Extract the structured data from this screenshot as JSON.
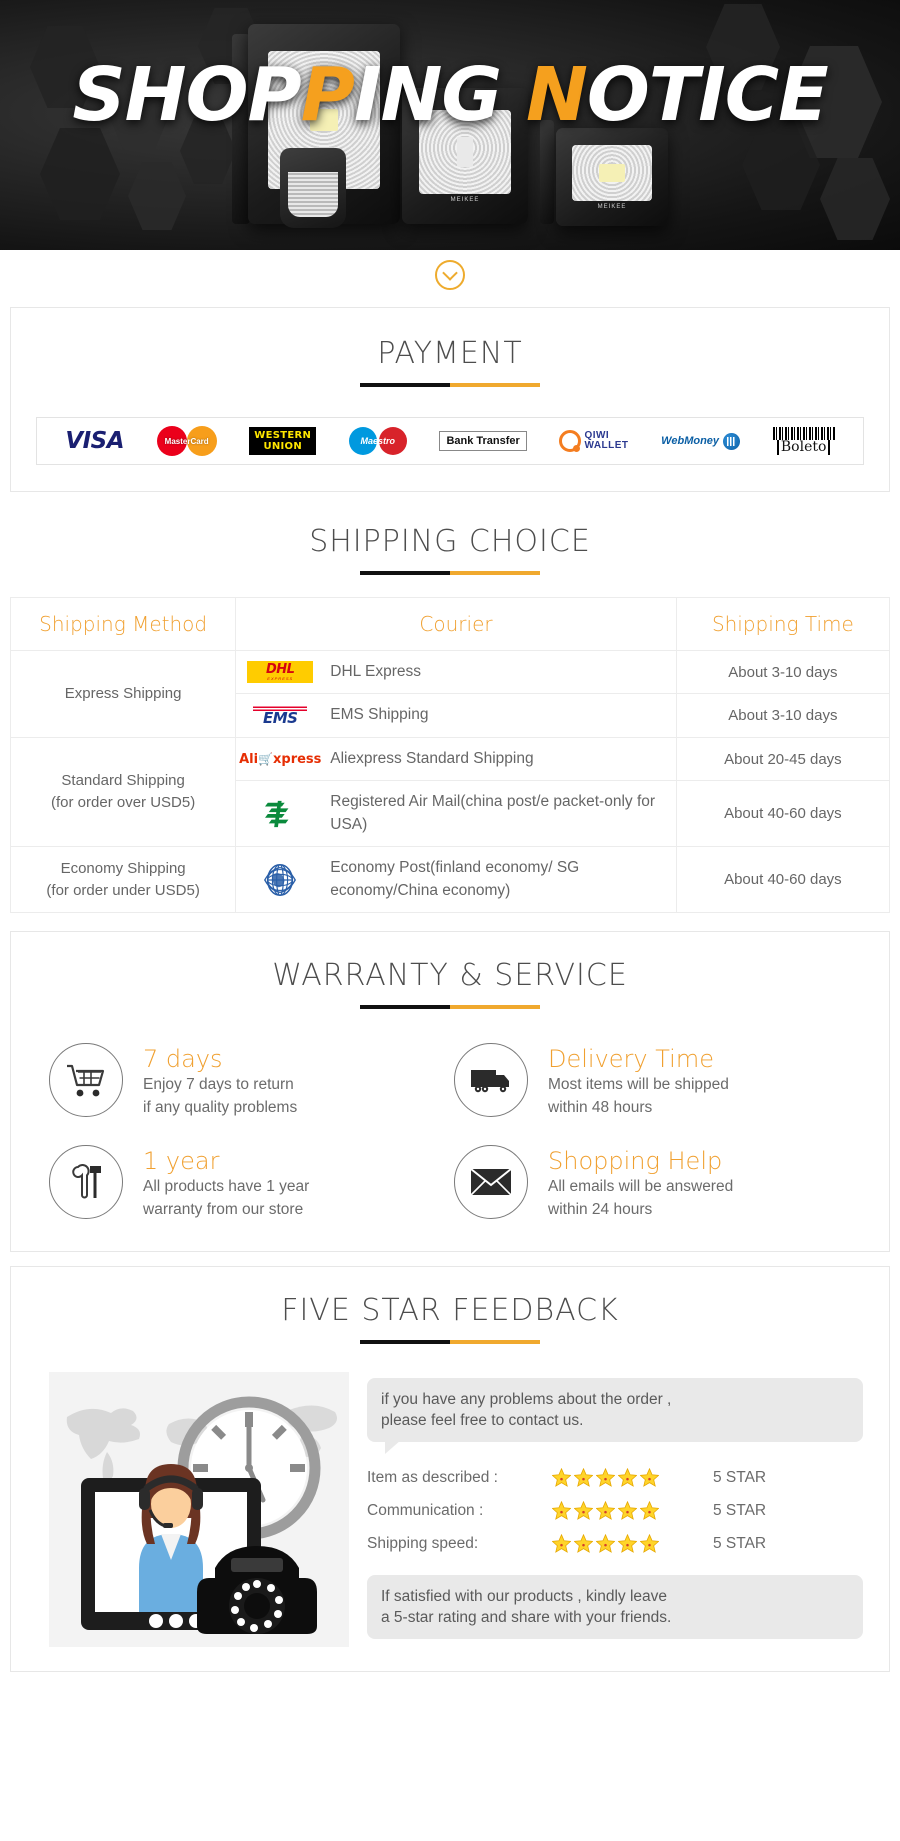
{
  "banner": {
    "title_part1": "SHOP",
    "title_accent1": "P",
    "title_part2": "ING ",
    "title_accent2": "N",
    "title_part3": "OTICE",
    "brand": "MEIKEE"
  },
  "scroll_hint": {
    "icon": "chevron-down-icon"
  },
  "payment": {
    "heading": "PAYMENT",
    "methods": [
      {
        "name": "VISA",
        "icon": "visa-logo"
      },
      {
        "name": "MasterCard",
        "icon": "mastercard-logo"
      },
      {
        "name": "WESTERN UNION",
        "line1": "WESTERN",
        "line2": "UNION",
        "icon": "western-union-logo"
      },
      {
        "name": "Maestro",
        "icon": "maestro-logo"
      },
      {
        "name": "Bank Transfer",
        "icon": "bank-transfer-logo"
      },
      {
        "name": "QIWI WALLET",
        "line1": "QIWI",
        "line2": "WALLET",
        "icon": "qiwi-wallet-logo"
      },
      {
        "name": "WebMoney",
        "icon": "webmoney-logo"
      },
      {
        "name": "Boleto",
        "icon": "boleto-logo"
      }
    ]
  },
  "shipping": {
    "heading": "SHIPPING CHOICE",
    "columns": [
      "Shipping Method",
      "Courier",
      "Shipping Time"
    ],
    "groups": [
      {
        "method": "Express Shipping",
        "method_note": "",
        "rows": [
          {
            "logo": "dhl-logo",
            "courier": "DHL Express",
            "time": "About 3-10 days"
          },
          {
            "logo": "ems-logo",
            "courier": "EMS Shipping",
            "time": "About 3-10 days"
          }
        ]
      },
      {
        "method": "Standard Shipping",
        "method_note": "(for order over USD5)",
        "rows": [
          {
            "logo": "aliexpress-logo",
            "courier": "Aliexpress Standard Shipping",
            "time": "About 20-45 days"
          },
          {
            "logo": "china-post-logo",
            "courier": "Registered Air Mail(china post/e packet-only for USA)",
            "time": "About 40-60 days"
          }
        ]
      },
      {
        "method": "Economy Shipping",
        "method_note": "(for order under USD5)",
        "rows": [
          {
            "logo": "un-post-logo",
            "courier": "Economy Post(finland economy/ SG economy/China economy)",
            "time": "About 40-60 days"
          }
        ]
      }
    ]
  },
  "warranty": {
    "heading": "WARRANTY & SERVICE",
    "features": [
      {
        "icon": "shopping-cart-icon",
        "title": "7 days",
        "desc_line1": "Enjoy 7 days to return",
        "desc_line2": "if any quality problems"
      },
      {
        "icon": "delivery-truck-icon",
        "title": "Delivery Time",
        "desc_line1": "Most items will be shipped",
        "desc_line2": "within 48 hours"
      },
      {
        "icon": "tools-icon",
        "title": "1 year",
        "desc_line1": "All products have 1 year",
        "desc_line2": "warranty from our store"
      },
      {
        "icon": "envelope-icon",
        "title": "Shopping Help",
        "desc_line1": "All emails will be answered",
        "desc_line2": "within 24 hours"
      }
    ]
  },
  "feedback": {
    "heading": "FIVE STAR FEEDBACK",
    "illustration": "customer-service-illustration",
    "top_bubble_line1": "if you have any problems about the order ,",
    "top_bubble_line2": "please feel free to contact us.",
    "ratings": [
      {
        "label": "Item as described :",
        "stars": 5,
        "value": "5 STAR"
      },
      {
        "label": "Communication :",
        "stars": 5,
        "value": "5 STAR"
      },
      {
        "label": "Shipping speed:",
        "stars": 5,
        "value": "5 STAR"
      }
    ],
    "bottom_bubble_line1": "If satisfied with our products , kindly leave",
    "bottom_bubble_line2": "a 5-star rating and share with your friends."
  },
  "colors": {
    "accent_orange": "#f0a030",
    "rule_dark": "#111111",
    "star_yellow": "#ffd42a",
    "text_gray": "#6b6b6b"
  }
}
